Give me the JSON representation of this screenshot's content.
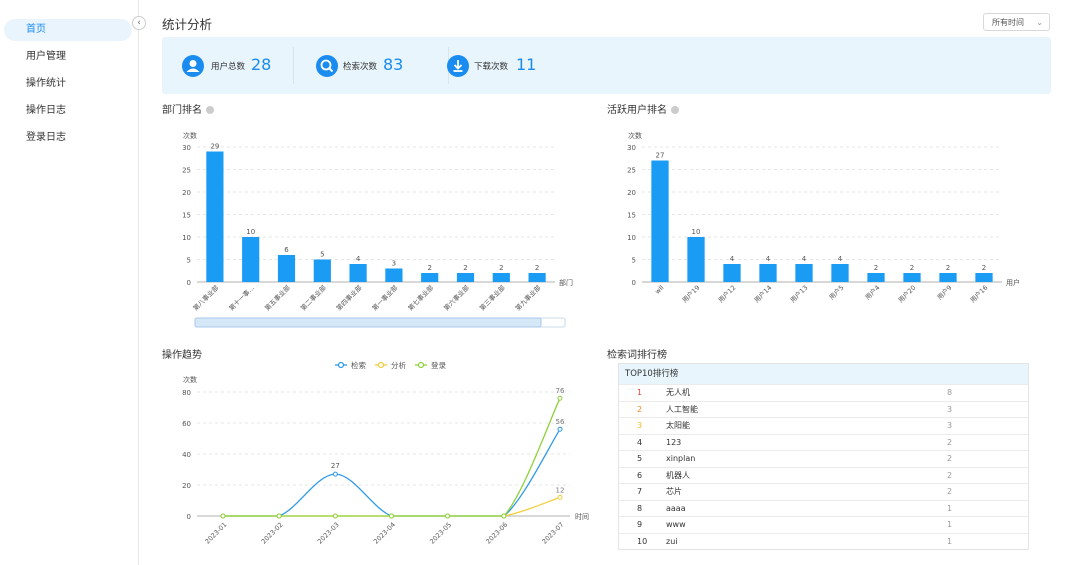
{
  "sidebar": {
    "items": [
      {
        "label": "首页",
        "active": true
      },
      {
        "label": "用户管理"
      },
      {
        "label": "操作统计"
      },
      {
        "label": "操作日志"
      },
      {
        "label": "登录日志"
      }
    ],
    "collapse_icon": "chevron-left-icon"
  },
  "header": {
    "title": "统计分析",
    "time_filter": "所有时间"
  },
  "stats": [
    {
      "label": "用户总数",
      "value": "28",
      "icon": "user-icon"
    },
    {
      "label": "检索次数",
      "value": "83",
      "icon": "search-icon"
    },
    {
      "label": "下载次数",
      "value": "11",
      "icon": "download-icon"
    }
  ],
  "sections": {
    "dept_rank": "部门排名",
    "active_user_rank": "活跃用户排名",
    "trend": "操作趋势",
    "keyword_rank": "检索词排行榜"
  },
  "chart_data": [
    {
      "type": "bar",
      "title": "部门排名",
      "ylabel": "次数",
      "xlabel": "部门",
      "ylim": [
        0,
        30
      ],
      "yticks": [
        0,
        5,
        10,
        15,
        20,
        25,
        30
      ],
      "categories": [
        "第八事业部",
        "第十一事…",
        "第五事业部",
        "第二事业部",
        "第四事业部",
        "第一事业部",
        "第七事业部",
        "第六事业部",
        "第三事业部",
        "第九事业部"
      ],
      "values": [
        29,
        10,
        6,
        5,
        4,
        3,
        2,
        2,
        2,
        2
      ],
      "value_labels": [
        "29",
        "10",
        "6",
        "5",
        "4",
        "3",
        "2",
        "2",
        "2",
        "2"
      ],
      "color": "#1a9cf5",
      "grid": true,
      "has_zoom_slider": true
    },
    {
      "type": "bar",
      "title": "活跃用户排名",
      "ylabel": "次数",
      "xlabel": "用户",
      "ylim": [
        0,
        30
      ],
      "yticks": [
        0,
        5,
        10,
        15,
        20,
        25,
        30
      ],
      "categories": [
        "wll",
        "用户19",
        "用户12",
        "用户14",
        "用户13",
        "用户5",
        "用户4",
        "用户20",
        "用户9",
        "用户16"
      ],
      "values": [
        27,
        10,
        4,
        4,
        4,
        4,
        2,
        2,
        2,
        2
      ],
      "value_labels": [
        "27",
        "10",
        "4",
        "4",
        "4",
        "4",
        "2",
        "2",
        "2",
        "2"
      ],
      "color": "#1a9cf5",
      "grid": true
    },
    {
      "type": "line",
      "title": "操作趋势",
      "ylabel": "次数",
      "xlabel": "时间",
      "ylim": [
        0,
        80
      ],
      "yticks": [
        0,
        20,
        40,
        60,
        80
      ],
      "x": [
        "2023-01",
        "2023-02",
        "2023-03",
        "2023-04",
        "2023-05",
        "2023-06",
        "2023-07"
      ],
      "legend_position": "top-center",
      "series": [
        {
          "name": "检索",
          "color": "#2e9ae8",
          "values": [
            0,
            0,
            27,
            0,
            0,
            0,
            56
          ],
          "end_label": "56"
        },
        {
          "name": "分析",
          "color": "#f5cd3c",
          "values": [
            0,
            0,
            0,
            0,
            0,
            0,
            12
          ],
          "end_label": "12"
        },
        {
          "name": "登录",
          "color": "#8fd13b",
          "values": [
            0,
            0,
            0,
            0,
            0,
            0,
            76
          ],
          "end_label": "76"
        }
      ],
      "peak_label": "27"
    }
  ],
  "keyword_table": {
    "header": "TOP10排行榜",
    "rows": [
      {
        "rank": "1",
        "keyword": "无人机",
        "count": "8",
        "color": "#e8413b"
      },
      {
        "rank": "2",
        "keyword": "人工智能",
        "count": "3",
        "color": "#f08a24"
      },
      {
        "rank": "3",
        "keyword": "太阳能",
        "count": "3",
        "color": "#f5b923"
      },
      {
        "rank": "4",
        "keyword": "123",
        "count": "2"
      },
      {
        "rank": "5",
        "keyword": "xinplan",
        "count": "2"
      },
      {
        "rank": "6",
        "keyword": "机器人",
        "count": "2"
      },
      {
        "rank": "7",
        "keyword": "芯片",
        "count": "2"
      },
      {
        "rank": "8",
        "keyword": "aaaa",
        "count": "1"
      },
      {
        "rank": "9",
        "keyword": "www",
        "count": "1"
      },
      {
        "rank": "10",
        "keyword": "zui",
        "count": "1"
      }
    ]
  }
}
